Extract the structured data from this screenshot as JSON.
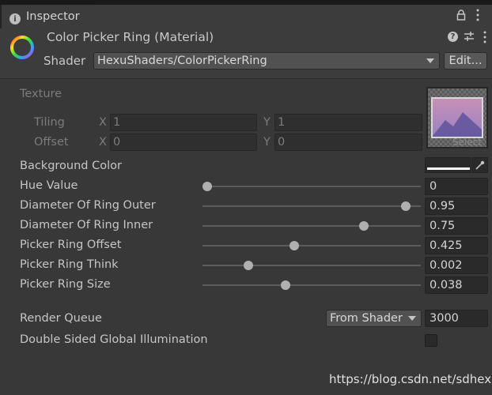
{
  "tab": {
    "icon": "info-icon",
    "title": "Inspector"
  },
  "header": {
    "material_name": "Color Picker Ring (Material)",
    "shader_label": "Shader",
    "shader_value": "HexuShaders/ColorPickerRing",
    "edit_label": "Edit..."
  },
  "texture": {
    "title": "Texture",
    "tiling_label": "Tiling",
    "offset_label": "Offset",
    "x_axis": "X",
    "y_axis": "Y",
    "tiling_x": "1",
    "tiling_y": "1",
    "offset_x": "0",
    "offset_y": "0",
    "select_label": "Select"
  },
  "properties": {
    "background_color": {
      "label": "Background Color",
      "color": "#ffffff"
    },
    "sliders": [
      {
        "label": "Hue Value",
        "value": "0",
        "fraction": 0.02
      },
      {
        "label": "Diameter Of Ring Outer",
        "value": "0.95",
        "fraction": 0.93
      },
      {
        "label": "Diameter Of Ring Inner",
        "value": "0.75",
        "fraction": 0.74
      },
      {
        "label": "Picker Ring Offset",
        "value": "0.425",
        "fraction": 0.42
      },
      {
        "label": "Picker Ring Think",
        "value": "0.002",
        "fraction": 0.21
      },
      {
        "label": "Picker Ring Size",
        "value": "0.038",
        "fraction": 0.38
      }
    ]
  },
  "render_queue": {
    "label": "Render Queue",
    "dropdown": "From Shader",
    "value": "3000"
  },
  "gi": {
    "label": "Double Sided Global Illumination",
    "checked": false
  },
  "watermark": "https://blog.csdn.net/sdhexu"
}
